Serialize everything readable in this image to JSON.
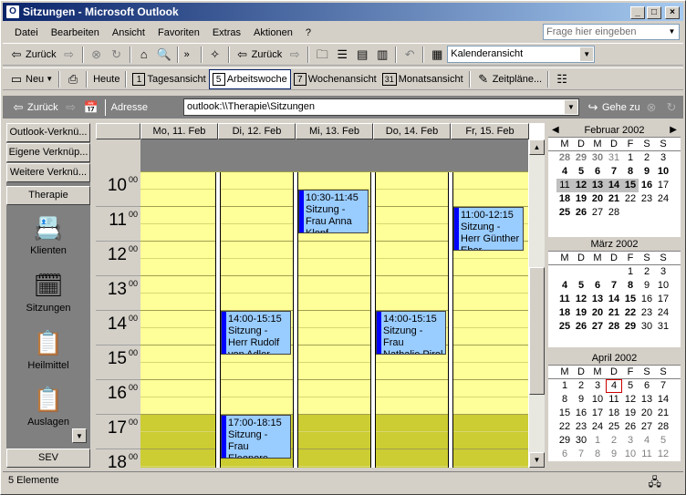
{
  "title": "Sitzungen - Microsoft Outlook",
  "menu": [
    "Datei",
    "Bearbeiten",
    "Ansicht",
    "Favoriten",
    "Extras",
    "Aktionen",
    "?"
  ],
  "help_placeholder": "Frage hier eingeben",
  "toolbar1": {
    "back": "Zurück",
    "back2": "Zurück",
    "view": "Kalenderansicht"
  },
  "toolbar2": {
    "new": "Neu",
    "today": "Heute",
    "day": "Tagesansicht",
    "workweek": "Arbeitswoche",
    "week": "Wochenansicht",
    "month": "Monatsansicht",
    "plans": "Zeitpläne..."
  },
  "nav": {
    "back": "Zurück",
    "address_label": "Adresse",
    "address": "outlook:\\\\Therapie\\Sitzungen",
    "go": "Gehe zu"
  },
  "sidebar": {
    "buttons": [
      "Outlook-Verknü...",
      "Eigene Verknüp...",
      "Weitere Verknü...",
      "Therapie"
    ],
    "items": [
      {
        "label": "Klienten",
        "icon": "rolodex-icon"
      },
      {
        "label": "Sitzungen",
        "icon": "sessions-icon"
      },
      {
        "label": "Heilmittel",
        "icon": "clipboard-icon"
      },
      {
        "label": "Auslagen",
        "icon": "clipboard-icon"
      }
    ],
    "bottom": "SEV"
  },
  "days": [
    "Mo, 11. Feb",
    "Di, 12. Feb",
    "Mi, 13. Feb",
    "Do, 14. Feb",
    "Fr, 15. Feb"
  ],
  "hours": [
    {
      "h": "10",
      "m": "00"
    },
    {
      "h": "11",
      "m": "00"
    },
    {
      "h": "12",
      "m": "00"
    },
    {
      "h": "13",
      "m": "00"
    },
    {
      "h": "14",
      "m": "00"
    },
    {
      "h": "15",
      "m": "00"
    },
    {
      "h": "16",
      "m": "00"
    },
    {
      "h": "17",
      "m": "00"
    },
    {
      "h": "18",
      "m": "00"
    }
  ],
  "appointments": [
    {
      "day": 2,
      "time": "10:30-11:45",
      "text": "Sitzung - Frau Anna Klopf"
    },
    {
      "day": 4,
      "time": "11:00-12:15",
      "text": "Sitzung - Herr Günther Eber"
    },
    {
      "day": 1,
      "time": "14:00-15:15",
      "text": "Sitzung - Herr Rudolf von Adler"
    },
    {
      "day": 3,
      "time": "14:00-15:15",
      "text": "Sitzung - Frau Nathalie Pirol"
    },
    {
      "day": 1,
      "time": "17:00-18:15",
      "text": "Sitzung - Frau Eleonore Perroquet"
    }
  ],
  "minical": {
    "weekdays": [
      "M",
      "D",
      "M",
      "D",
      "F",
      "S",
      "S"
    ],
    "months": [
      {
        "name": "Februar 2002",
        "weeks": [
          [
            "28",
            "29",
            "30",
            "31",
            "1",
            "2",
            "3"
          ],
          [
            "4",
            "5",
            "6",
            "7",
            "8",
            "9",
            "10"
          ],
          [
            "11",
            "12",
            "13",
            "14",
            "15",
            "16",
            "17"
          ],
          [
            "18",
            "19",
            "20",
            "21",
            "22",
            "23",
            "24"
          ],
          [
            "25",
            "26",
            "27",
            "28",
            "",
            "",
            ""
          ]
        ]
      },
      {
        "name": "März 2002",
        "weeks": [
          [
            "",
            "",
            "",
            "",
            "1",
            "2",
            "3"
          ],
          [
            "4",
            "5",
            "6",
            "7",
            "8",
            "9",
            "10"
          ],
          [
            "11",
            "12",
            "13",
            "14",
            "15",
            "16",
            "17"
          ],
          [
            "18",
            "19",
            "20",
            "21",
            "22",
            "23",
            "24"
          ],
          [
            "25",
            "26",
            "27",
            "28",
            "29",
            "30",
            "31"
          ]
        ]
      },
      {
        "name": "April 2002",
        "weeks": [
          [
            "1",
            "2",
            "3",
            "4",
            "5",
            "6",
            "7"
          ],
          [
            "8",
            "9",
            "10",
            "11",
            "12",
            "13",
            "14"
          ],
          [
            "15",
            "16",
            "17",
            "18",
            "19",
            "20",
            "21"
          ],
          [
            "22",
            "23",
            "24",
            "25",
            "26",
            "27",
            "28"
          ],
          [
            "29",
            "30",
            "1",
            "2",
            "3",
            "4",
            "5"
          ],
          [
            "6",
            "7",
            "8",
            "9",
            "10",
            "11",
            "12"
          ]
        ]
      }
    ]
  },
  "status": "5 Elemente"
}
